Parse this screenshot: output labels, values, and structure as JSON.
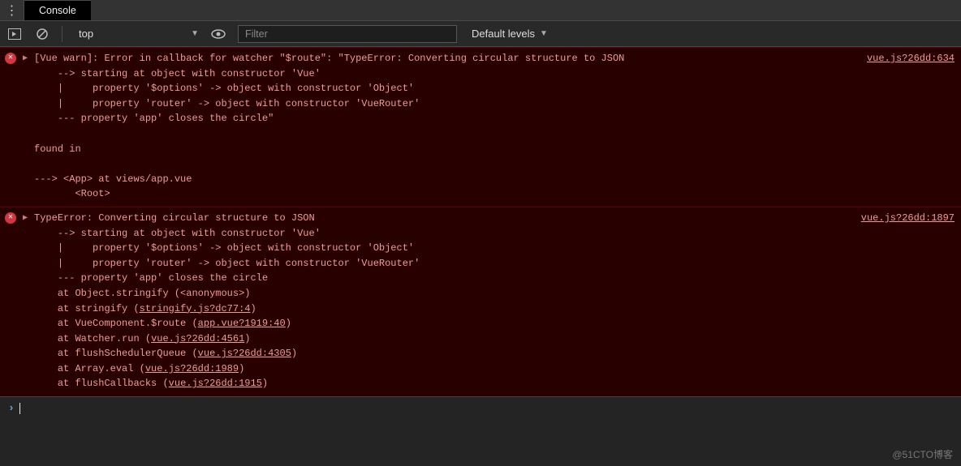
{
  "tab": {
    "label": "Console"
  },
  "toolbar": {
    "context": "top",
    "filter_placeholder": "Filter",
    "levels_label": "Default levels"
  },
  "errors": [
    {
      "source": "vue.js?26dd:634",
      "lines": [
        "[Vue warn]: Error in callback for watcher \"$route\": \"TypeError: Converting circular structure to JSON",
        "    --> starting at object with constructor 'Vue'",
        "    |     property '$options' -> object with constructor 'Object'",
        "    |     property 'router' -> object with constructor 'VueRouter'",
        "    --- property 'app' closes the circle\"",
        "",
        "found in",
        "",
        "---> <App> at views/app.vue",
        "       <Root>"
      ]
    },
    {
      "source": "vue.js?26dd:1897",
      "lines_pre": [
        "TypeError: Converting circular structure to JSON",
        "    --> starting at object with constructor 'Vue'",
        "    |     property '$options' -> object with constructor 'Object'",
        "    |     property 'router' -> object with constructor 'VueRouter'",
        "    --- property 'app' closes the circle",
        "    at Object.stringify (<anonymous>)"
      ],
      "trace": [
        {
          "prefix": "    at stringify (",
          "link": "stringify.js?dc77:4",
          "suffix": ")"
        },
        {
          "prefix": "    at VueComponent.$route (",
          "link": "app.vue?1919:40",
          "suffix": ")"
        },
        {
          "prefix": "    at Watcher.run (",
          "link": "vue.js?26dd:4561",
          "suffix": ")"
        },
        {
          "prefix": "    at flushSchedulerQueue (",
          "link": "vue.js?26dd:4305",
          "suffix": ")"
        },
        {
          "prefix": "    at Array.eval (",
          "link": "vue.js?26dd:1989",
          "suffix": ")"
        },
        {
          "prefix": "    at flushCallbacks (",
          "link": "vue.js?26dd:1915",
          "suffix": ")"
        }
      ]
    }
  ],
  "watermark": "@51CTO博客"
}
